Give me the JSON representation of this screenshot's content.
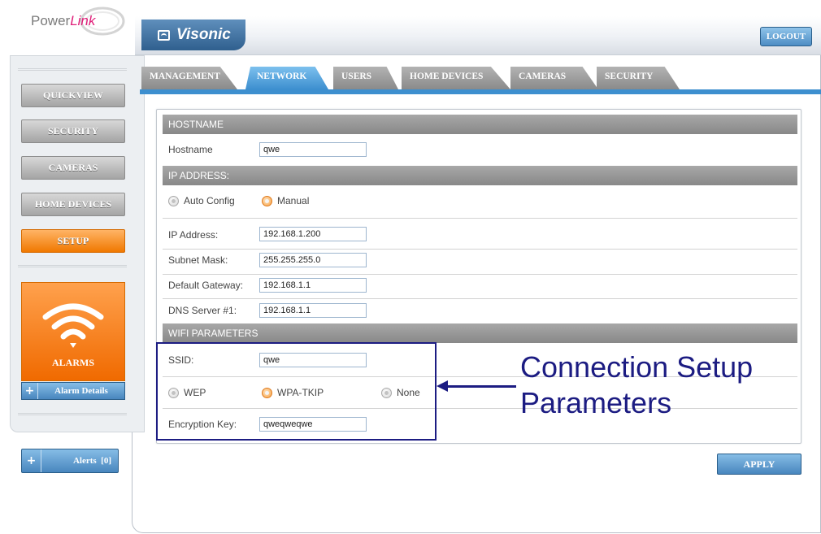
{
  "logo": {
    "text_part1": "Power",
    "text_part2": "Link"
  },
  "header": {
    "brand": "Visonic",
    "logout_label": "LOGOUT"
  },
  "sidebar": {
    "items": [
      {
        "label": "QUICKVIEW"
      },
      {
        "label": "SECURITY"
      },
      {
        "label": "CAMERAS"
      },
      {
        "label": "HOME DEVICES"
      },
      {
        "label": "SETUP"
      }
    ],
    "alarms_label": "ALARMS",
    "alarm_details_label": "Alarm Details",
    "alerts_label": "Alerts",
    "alerts_count": "[0]",
    "plus_symbol": "+"
  },
  "tabs": [
    {
      "label": "MANAGEMENT"
    },
    {
      "label": "NETWORK"
    },
    {
      "label": "USERS"
    },
    {
      "label": "HOME DEVICES"
    },
    {
      "label": "CAMERAS"
    },
    {
      "label": "SECURITY"
    }
  ],
  "form": {
    "hostname_section": "HOSTNAME",
    "hostname_label": "Hostname",
    "hostname_value": "qwe",
    "ip_section": "IP ADDRESS:",
    "auto_config_label": "Auto Config",
    "manual_label": "Manual",
    "ip_label": "IP Address:",
    "ip_value": "192.168.1.200",
    "subnet_label": "Subnet Mask:",
    "subnet_value": "255.255.255.0",
    "gateway_label": "Default Gateway:",
    "gateway_value": "192.168.1.1",
    "dns_label": "DNS Server #1:",
    "dns_value": "192.168.1.1",
    "wifi_section": "WIFI PARAMETERS",
    "ssid_label": "SSID:",
    "ssid_value": "qwe",
    "wep_label": "WEP",
    "wpa_label": "WPA-TKIP",
    "none_label": "None",
    "key_label": "Encryption Key:",
    "key_value": "qweqweqwe",
    "apply_label": "APPLY"
  },
  "annotation": {
    "line1": "Connection Setup",
    "line2": "Parameters"
  },
  "colors": {
    "accent_blue": "#3d8fcf",
    "active_orange": "#f07800",
    "annotation_navy": "#1c1c82",
    "section_gray": "#888888"
  }
}
